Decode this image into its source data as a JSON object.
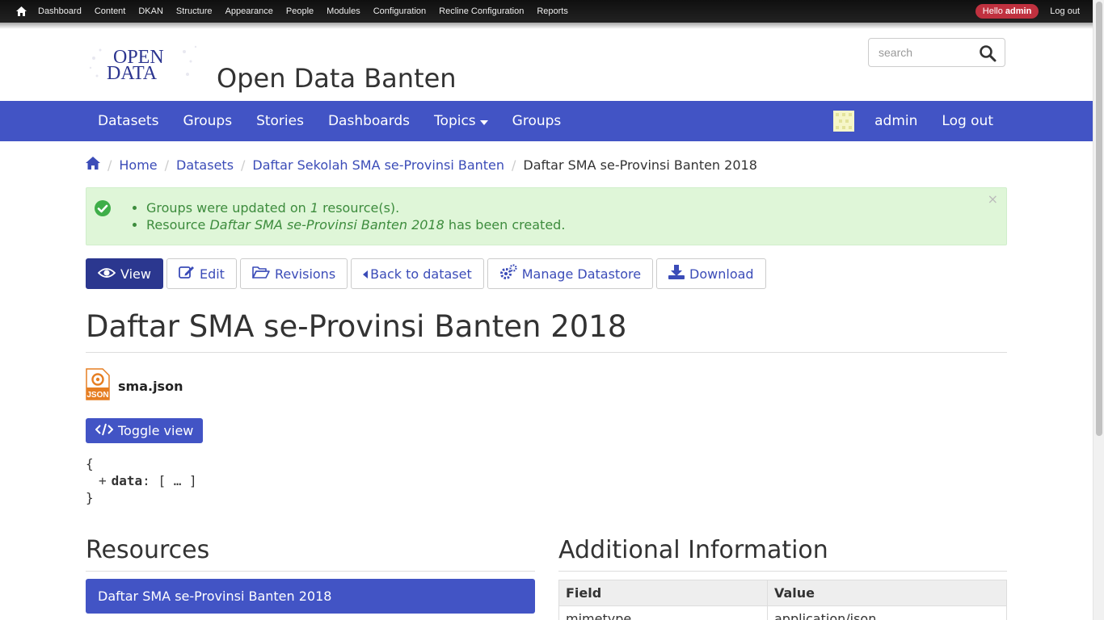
{
  "admin_bar": {
    "menu": [
      "Dashboard",
      "Content",
      "DKAN",
      "Structure",
      "Appearance",
      "People",
      "Modules",
      "Configuration",
      "Recline Configuration",
      "Reports"
    ],
    "hello_prefix": "Hello ",
    "hello_user": "admin",
    "logout": "Log out"
  },
  "header": {
    "logo_line1": "OPEN",
    "logo_line2": "DATA",
    "site_name": "Open Data Banten",
    "search_placeholder": "search"
  },
  "main_nav": {
    "left": [
      "Datasets",
      "Groups",
      "Stories",
      "Dashboards",
      "Topics",
      "Groups"
    ],
    "right_user": "admin",
    "right_logout": "Log out"
  },
  "breadcrumb": {
    "items": [
      "Home",
      "Datasets",
      "Daftar Sekolah SMA se-Provinsi Banten"
    ],
    "current": "Daftar SMA se-Provinsi Banten 2018"
  },
  "messages": {
    "m1_prefix": "Groups were updated on ",
    "m1_count": "1",
    "m1_suffix": " resource(s).",
    "m2_prefix": "Resource ",
    "m2_name": "Daftar SMA se-Provinsi Banten 2018",
    "m2_suffix": " has been created.",
    "close": "×"
  },
  "tabs": {
    "view": "View",
    "edit": "Edit",
    "revisions": "Revisions",
    "back": "Back to dataset",
    "datastore": "Manage Datastore",
    "download": "Download"
  },
  "page_title": "Daftar SMA se-Provinsi Banten 2018",
  "file": {
    "icon_label": "JSON",
    "name": "sma.json"
  },
  "toggle_view": "Toggle view",
  "json_preview": {
    "open": "{",
    "plus": "+",
    "key": "data",
    "value": ": [ … ]",
    "close": "}"
  },
  "resources": {
    "title": "Resources",
    "items": [
      "Daftar SMA se-Provinsi Banten 2018"
    ]
  },
  "additional_info": {
    "title": "Additional Information",
    "headers": [
      "Field",
      "Value"
    ],
    "rows": [
      [
        "mimetype",
        "application/json"
      ]
    ]
  },
  "colors": {
    "nav": "#4254c5",
    "active_tab": "#2b378f",
    "link": "#3b4cb8",
    "success_bg": "#dff6d8",
    "success_text": "#3d8c3d",
    "hello_badge": "#c0313f"
  }
}
